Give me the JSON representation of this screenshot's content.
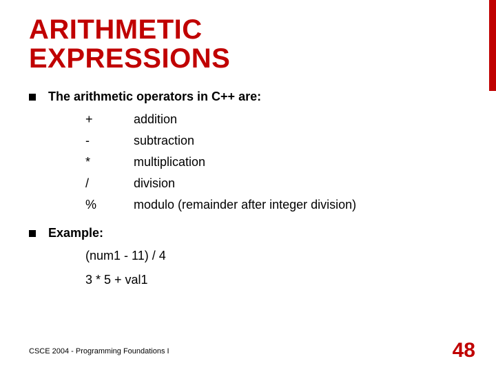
{
  "title_line1": "ARITHMETIC",
  "title_line2": "EXPRESSIONS",
  "bullet1": "The arithmetic operators in C++ are:",
  "operators": [
    {
      "symbol": "+",
      "name": "addition"
    },
    {
      "symbol": "-",
      "name": "subtraction"
    },
    {
      "symbol": "*",
      "name": "multiplication"
    },
    {
      "symbol": "/",
      "name": "division"
    },
    {
      "symbol": "%",
      "name": "modulo (remainder after integer division)"
    }
  ],
  "bullet2": "Example:",
  "examples": [
    "(num1 - 11) / 4",
    "3 * 5 + val1"
  ],
  "footer_left": "CSCE 2004 - Programming Foundations I",
  "page_number": "48",
  "colors": {
    "accent": "#c00000"
  }
}
